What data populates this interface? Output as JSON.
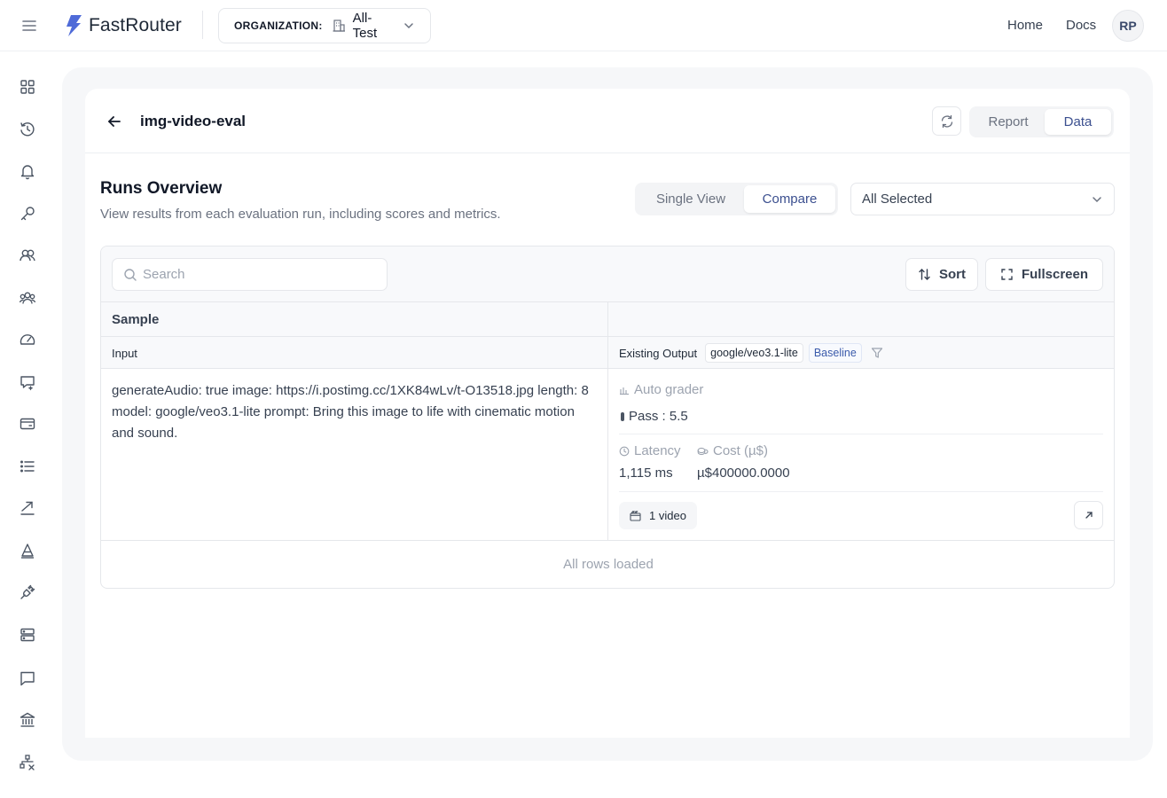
{
  "app": {
    "name": "FastRouter"
  },
  "header": {
    "org_label": "ORGANIZATION:",
    "org_value": "All-Test",
    "nav": [
      "Home",
      "Docs"
    ],
    "avatar_initials": "RP"
  },
  "sidebar": {
    "items": [
      "dashboard-icon",
      "history-icon",
      "bell-icon",
      "key-icon",
      "users-icon",
      "team-icon",
      "gauge-icon",
      "chat-sparkle-icon",
      "credit-card-icon",
      "list-icon",
      "trend-arrow-icon",
      "triangle-a-icon",
      "plug-icon",
      "server-icon",
      "message-icon",
      "bank-icon",
      "network-icon"
    ]
  },
  "page": {
    "title": "img-video-eval",
    "tabs": [
      "Report",
      "Data"
    ],
    "active_tab": "Data"
  },
  "overview": {
    "title": "Runs Overview",
    "subtitle": "View results from each evaluation run, including scores and metrics.",
    "view_modes": [
      "Single View",
      "Compare"
    ],
    "active_view": "Compare",
    "run_select": "All Selected"
  },
  "toolbar": {
    "search_placeholder": "Search",
    "sort_label": "Sort",
    "fullscreen_label": "Fullscreen"
  },
  "table": {
    "group_header": "Sample",
    "input_header": "Input",
    "output_header": "Existing Output",
    "model_tag": "google/veo3.1-lite",
    "baseline_tag": "Baseline",
    "rows": [
      {
        "input": "generateAudio: true image: https://i.postimg.cc/1XK84wLv/t-O13518.jpg length: 8 model: google/veo3.1-lite prompt: Bring this image to life with cinematic motion and sound.",
        "grader_label": "Auto grader",
        "pass_text": "Pass : 5.5",
        "latency_label": "Latency",
        "latency_value": "1,115 ms",
        "cost_label": "Cost (µ$)",
        "cost_value": "µ$400000.0000",
        "media_label": "1 video"
      }
    ],
    "footer": "All rows loaded"
  },
  "colors": {
    "accent": "#3b4f8f",
    "logo": "#4f6bd8",
    "border": "#e5e7eb",
    "muted": "#9ca3af"
  }
}
